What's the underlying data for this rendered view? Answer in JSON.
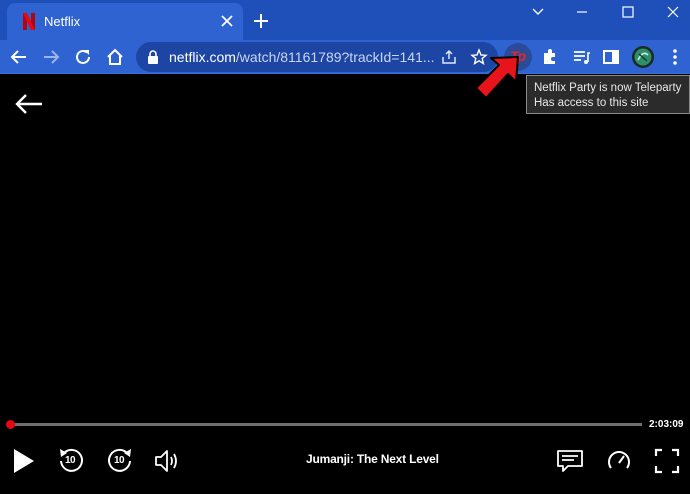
{
  "browser": {
    "tab": {
      "title": "Netflix"
    },
    "address_bar": {
      "host": "netflix.com",
      "path": "/watch/81161789?trackId=141..."
    },
    "extension": {
      "label": "Tp",
      "tooltip_line1": "Netflix Party is now Teleparty",
      "tooltip_line2": "Has access to this site"
    }
  },
  "player": {
    "title": "Jumanji: The Next Level",
    "time_remaining": "2:03:09",
    "progress": 0.003,
    "skip_seconds": "10"
  },
  "colors": {
    "chrome_dark": "#1f4fb8",
    "chrome_light": "#2f63d2",
    "netflix_red": "#e50914"
  },
  "icons": [
    "netflix-favicon",
    "close-icon",
    "plus-icon",
    "minimize-icon",
    "maximize-icon",
    "window-close-icon",
    "back-icon",
    "forward-icon",
    "reload-icon",
    "home-icon",
    "lock-icon",
    "share-icon",
    "star-icon",
    "puzzle-icon",
    "media-queue-icon",
    "side-panel-icon",
    "profile-avatar",
    "kebab-menu-icon",
    "arrow-left-icon",
    "play-icon",
    "rewind-10-icon",
    "forward-10-icon",
    "volume-icon",
    "subtitles-icon",
    "speed-icon",
    "fullscreen-icon"
  ]
}
